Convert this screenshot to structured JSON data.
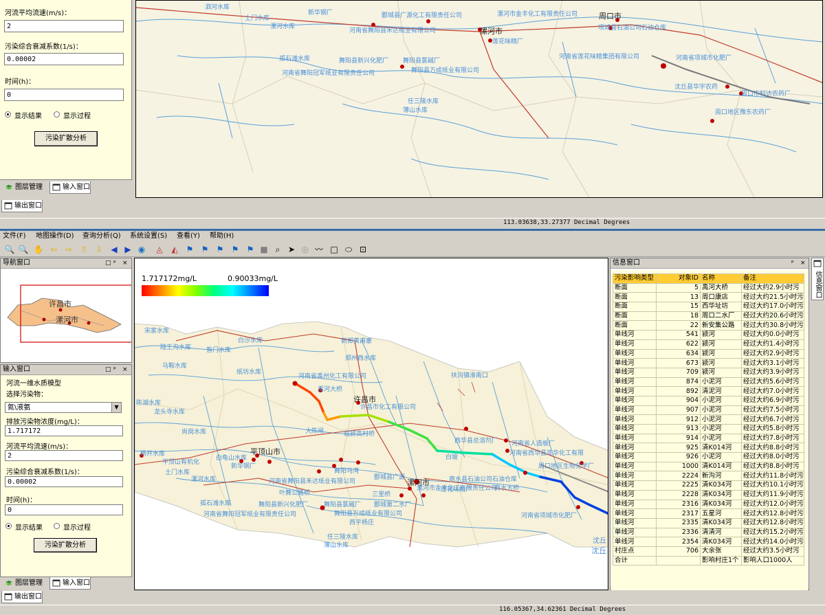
{
  "top": {
    "flow_label": "河流平均流速(m/s)：",
    "flow_value": "2",
    "decay_label": "污染综合衰减系数(1/s)：",
    "decay_value": "0.00002",
    "time_label": "时间(h)：",
    "time_value": "0",
    "radio_result": "显示结果",
    "radio_process": "显示过程",
    "analyze_button": "污染扩散分析",
    "tab_layers": "图层管理",
    "tab_input": "输入窗口",
    "output_tab": "输出窗口",
    "coords": "113.03638,33.27377 Decimal Degrees",
    "map_labels": [
      "泗河水库",
      "新华钢厂",
      "土门水库",
      "漯河水库",
      "郾城县广源化工有限责任公司",
      "漯河市金丰化工有限责任公司",
      "周口市",
      "河南省舞阳县禾达纸业有限公司",
      "漯河市",
      "莲花味精厂",
      "项城县石油公司石油仓库",
      "孤石滩水库",
      "舞阳县新兴化肥厂",
      "舞阳县氯碱厂",
      "河南省莲花味精集团有限公司",
      "河南省项城市化肥厂",
      "河南省舞阳冠军纸业有限责任公司",
      "舞阳县万成纸业有限公司",
      "沈丘县华宇农药",
      "周口市科达农药厂",
      "任三陵水库",
      "薄山水库",
      "周口地区豫东农药厂"
    ]
  },
  "menu": {
    "items": [
      "文件(F)",
      "地图操作(D)",
      "查询分析(Q)",
      "系统设置(S)",
      "查看(Y)",
      "帮助(H)"
    ]
  },
  "nav": {
    "title": "导航窗口",
    "city1": "许昌市",
    "city2": "漯河市"
  },
  "input": {
    "title": "输入窗口",
    "model_label": "河流一维水质模型",
    "pollutant_label": "选择污染物：",
    "pollutant_value": "氮\\液氨",
    "conc_label": "排放污染物浓度(mg/L)：",
    "conc_value": "1.717172",
    "flow_label": "河流平均流速(m/s)：",
    "flow_value": "2",
    "decay_label": "污染综合衰减系数(1/s)：",
    "decay_value": "0.00002",
    "time_label": "时间(h)：",
    "time_value": "0",
    "radio_result": "显示结果",
    "radio_process": "显示过程",
    "analyze_button": "污染扩散分析",
    "tab_layers": "图层管理",
    "tab_input": "输入窗口",
    "output_tab": "输出窗口"
  },
  "legend": {
    "max_label": "1.717172mg/L",
    "min_label": "0.90033mg/L"
  },
  "main_map": {
    "map_labels": [
      "宋家水库",
      "陆王沟水库",
      "昝门水库",
      "白沙水库",
      "新郑黄甫寨",
      "郑州西水库",
      "马鞍水库",
      "纸坊水库",
      "河南省禹州化工有限公司",
      "扶沟镇淮南口",
      "禹河大桥",
      "许昌市",
      "许昌市化工有限公司",
      "陈湖水库",
      "龙头寺水库",
      "大陈闸",
      "临颍高村桥",
      "西华县总溶剂厂",
      "河南省人造板厂",
      "尚岗水库",
      "河南省西华县亚华化工有限",
      "平顶山市",
      "白龟山水库",
      "杨开水库",
      "平顶山有机化",
      "新华钢厂",
      "白坡",
      "周口地区生物化学厂",
      "土门水库",
      "舞阳马湾",
      "漯河水库",
      "孤石滩水库",
      "河南省舞阳县禾达纸业有限公司",
      "漯河市",
      "漯河市金丰化工有限责任公司",
      "商水县石油公司石油仓库",
      "叶舞公路桥",
      "三里桥",
      "郾城县广源",
      "莲花味精厂",
      "商水大桥",
      "舞阳县新兴化肥厂",
      "舞阳县氯碱厂",
      "郾城第二水厂",
      "河南省项城市化肥厂",
      "河南省舞阳冠军纸业有限责任公司",
      "舞阳县万成纸业有限公司",
      "西平杨庄",
      "任三陵水库",
      "薄山水库",
      "沈丘",
      "沈丘"
    ]
  },
  "info": {
    "title": "信息窗口",
    "side_tab": "信息窗口",
    "columns": [
      "污染影响类型",
      "对象ID",
      "名称",
      "备注"
    ],
    "rows": [
      [
        "断面",
        "5",
        "禹河大桥",
        "经过大约2.9小时污"
      ],
      [
        "断面",
        "13",
        "周口康店",
        "经过大约21.5小时污"
      ],
      [
        "断面",
        "15",
        "西华址坊",
        "经过大约17.0小时污"
      ],
      [
        "断面",
        "18",
        "周口二水厂",
        "经过大约20.6小时污"
      ],
      [
        "断面",
        "22",
        "新安集公路",
        "经过大约30.8小时污"
      ],
      [
        "单线河",
        "541",
        "颍河",
        "经过大约0.0小时污"
      ],
      [
        "单线河",
        "622",
        "颍河",
        "经过大约1.4小时污"
      ],
      [
        "单线河",
        "634",
        "颍河",
        "经过大约2.9小时污"
      ],
      [
        "单线河",
        "673",
        "颍河",
        "经过大约3.1小时污"
      ],
      [
        "单线河",
        "709",
        "颍河",
        "经过大约3.9小时污"
      ],
      [
        "单线河",
        "874",
        "小泥河",
        "经过大约5.6小时污"
      ],
      [
        "单线河",
        "892",
        "清泥河",
        "经过大约7.0小时污"
      ],
      [
        "单线河",
        "904",
        "小泥河",
        "经过大约6.9小时污"
      ],
      [
        "单线河",
        "907",
        "小泥河",
        "经过大约7.5小时污"
      ],
      [
        "单线河",
        "912",
        "小泥河",
        "经过大约6.7小时污"
      ],
      [
        "单线河",
        "913",
        "小泥河",
        "经过大约5.8小时污"
      ],
      [
        "单线河",
        "914",
        "小泥河",
        "经过大约7.8小时污"
      ],
      [
        "单线河",
        "925",
        "清K014河",
        "经过大约8.8小时污"
      ],
      [
        "单线河",
        "926",
        "小泥河",
        "经过大约8.0小时污"
      ],
      [
        "单线河",
        "1000",
        "清K014河",
        "经过大约8.8小时污"
      ],
      [
        "单线河",
        "2224",
        "新沟河",
        "经过大约11.8小时污"
      ],
      [
        "单线河",
        "2225",
        "清K034河",
        "经过大约10.1小时污"
      ],
      [
        "单线河",
        "2228",
        "清K034河",
        "经过大约11.9小时污"
      ],
      [
        "单线河",
        "2316",
        "清K034河",
        "经过大约12.0小时污"
      ],
      [
        "单线河",
        "2317",
        "五星河",
        "经过大约12.8小时污"
      ],
      [
        "单线河",
        "2335",
        "清K034河",
        "经过大约12.8小时污"
      ],
      [
        "单线河",
        "2336",
        "清清河",
        "经过大约15.2小时污"
      ],
      [
        "单线河",
        "2354",
        "清K034河",
        "经过大约14.0小时污"
      ],
      [
        "村庄点",
        "706",
        "大余张",
        "经过大约3.5小时污"
      ]
    ],
    "total": [
      "合计",
      "",
      "影响村庄1个",
      "影响人口1000人"
    ]
  },
  "status": {
    "coords": "116.05367,34.62361 Decimal Degrees"
  }
}
